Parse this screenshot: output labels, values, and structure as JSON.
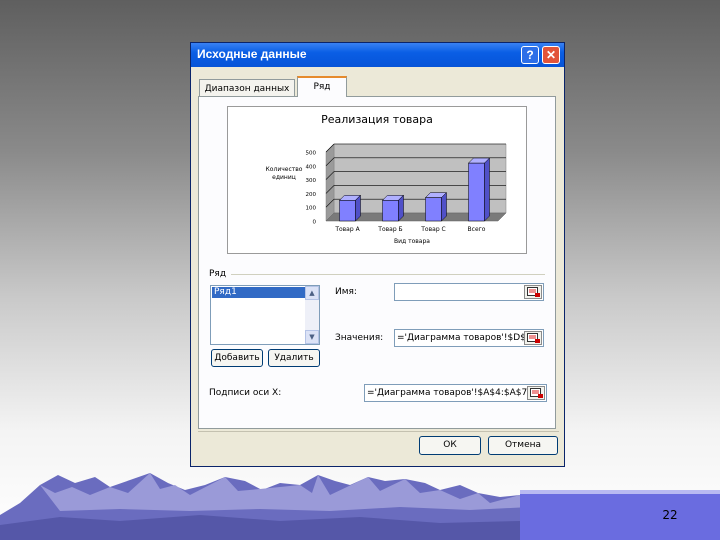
{
  "dialog": {
    "title": "Исходные данные",
    "help_label": "?",
    "close_label": "✕"
  },
  "tabs": [
    {
      "label": "Диапазон данных"
    },
    {
      "label": "Ряд"
    }
  ],
  "chart_data": {
    "type": "bar",
    "title": "Реализация товара",
    "xlabel": "Вид товара",
    "ylabel": "Количество единиц",
    "categories": [
      "Товар А",
      "Товар Б",
      "Товар С",
      "Всего"
    ],
    "values": [
      150,
      150,
      170,
      420
    ],
    "ylim": [
      0,
      500
    ],
    "yticks": [
      "0",
      "100",
      "200",
      "300",
      "400",
      "500"
    ],
    "bar_color": "#8080ff",
    "grid": true
  },
  "series_section": {
    "label": "Ряд",
    "items": [
      "Ряд1"
    ],
    "add_label": "Добавить",
    "remove_label": "Удалить"
  },
  "fields": {
    "name_label": "Имя:",
    "name_value": "",
    "values_label": "Значения:",
    "values_value": "='Диаграмма товаров'!$D$",
    "xlabels_label": "Подписи оси X:",
    "xlabels_value": "='Диаграмма товаров'!$A$4:$A$7"
  },
  "buttons": {
    "ok_label": "ОК",
    "cancel_label": "Отмена"
  },
  "slide": {
    "page_number": "22"
  },
  "colors": {
    "titlebar": "#0754d8",
    "accent_bar": "#6a6ce0",
    "mountain": "#6a6cc0"
  }
}
